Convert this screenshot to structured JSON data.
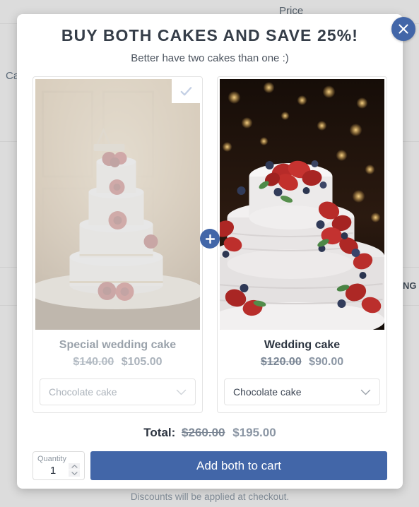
{
  "background_page": {
    "price_header": "Price",
    "left_partial": "Ca",
    "right_partial": "NG"
  },
  "modal": {
    "title": "BUY BOTH CAKES AND SAVE 25%!",
    "subtitle": "Better have two cakes than one :)",
    "close_icon": "close-icon",
    "combine_icon": "plus-icon",
    "selected_icon": "check-icon",
    "accent_color": "#4266a8",
    "products": [
      {
        "name": "Special wedding cake",
        "old_price": "$140.00",
        "new_price": "$105.00",
        "variant_value": "Chocolate cake",
        "selected": true,
        "image_alt": "four-tier white wedding cake with red roses"
      },
      {
        "name": "Wedding cake",
        "old_price": "$120.00",
        "new_price": "$90.00",
        "variant_value": "Chocolate cake",
        "selected": false,
        "image_alt": "three-tier white cake with strawberries and blueberries"
      }
    ],
    "total": {
      "label": "Total:",
      "old_price": "$260.00",
      "new_price": "$195.00"
    },
    "quantity": {
      "label": "Quantity",
      "value": "1"
    },
    "cta_label": "Add both to cart",
    "footnote": "Discounts will be applied at checkout."
  }
}
